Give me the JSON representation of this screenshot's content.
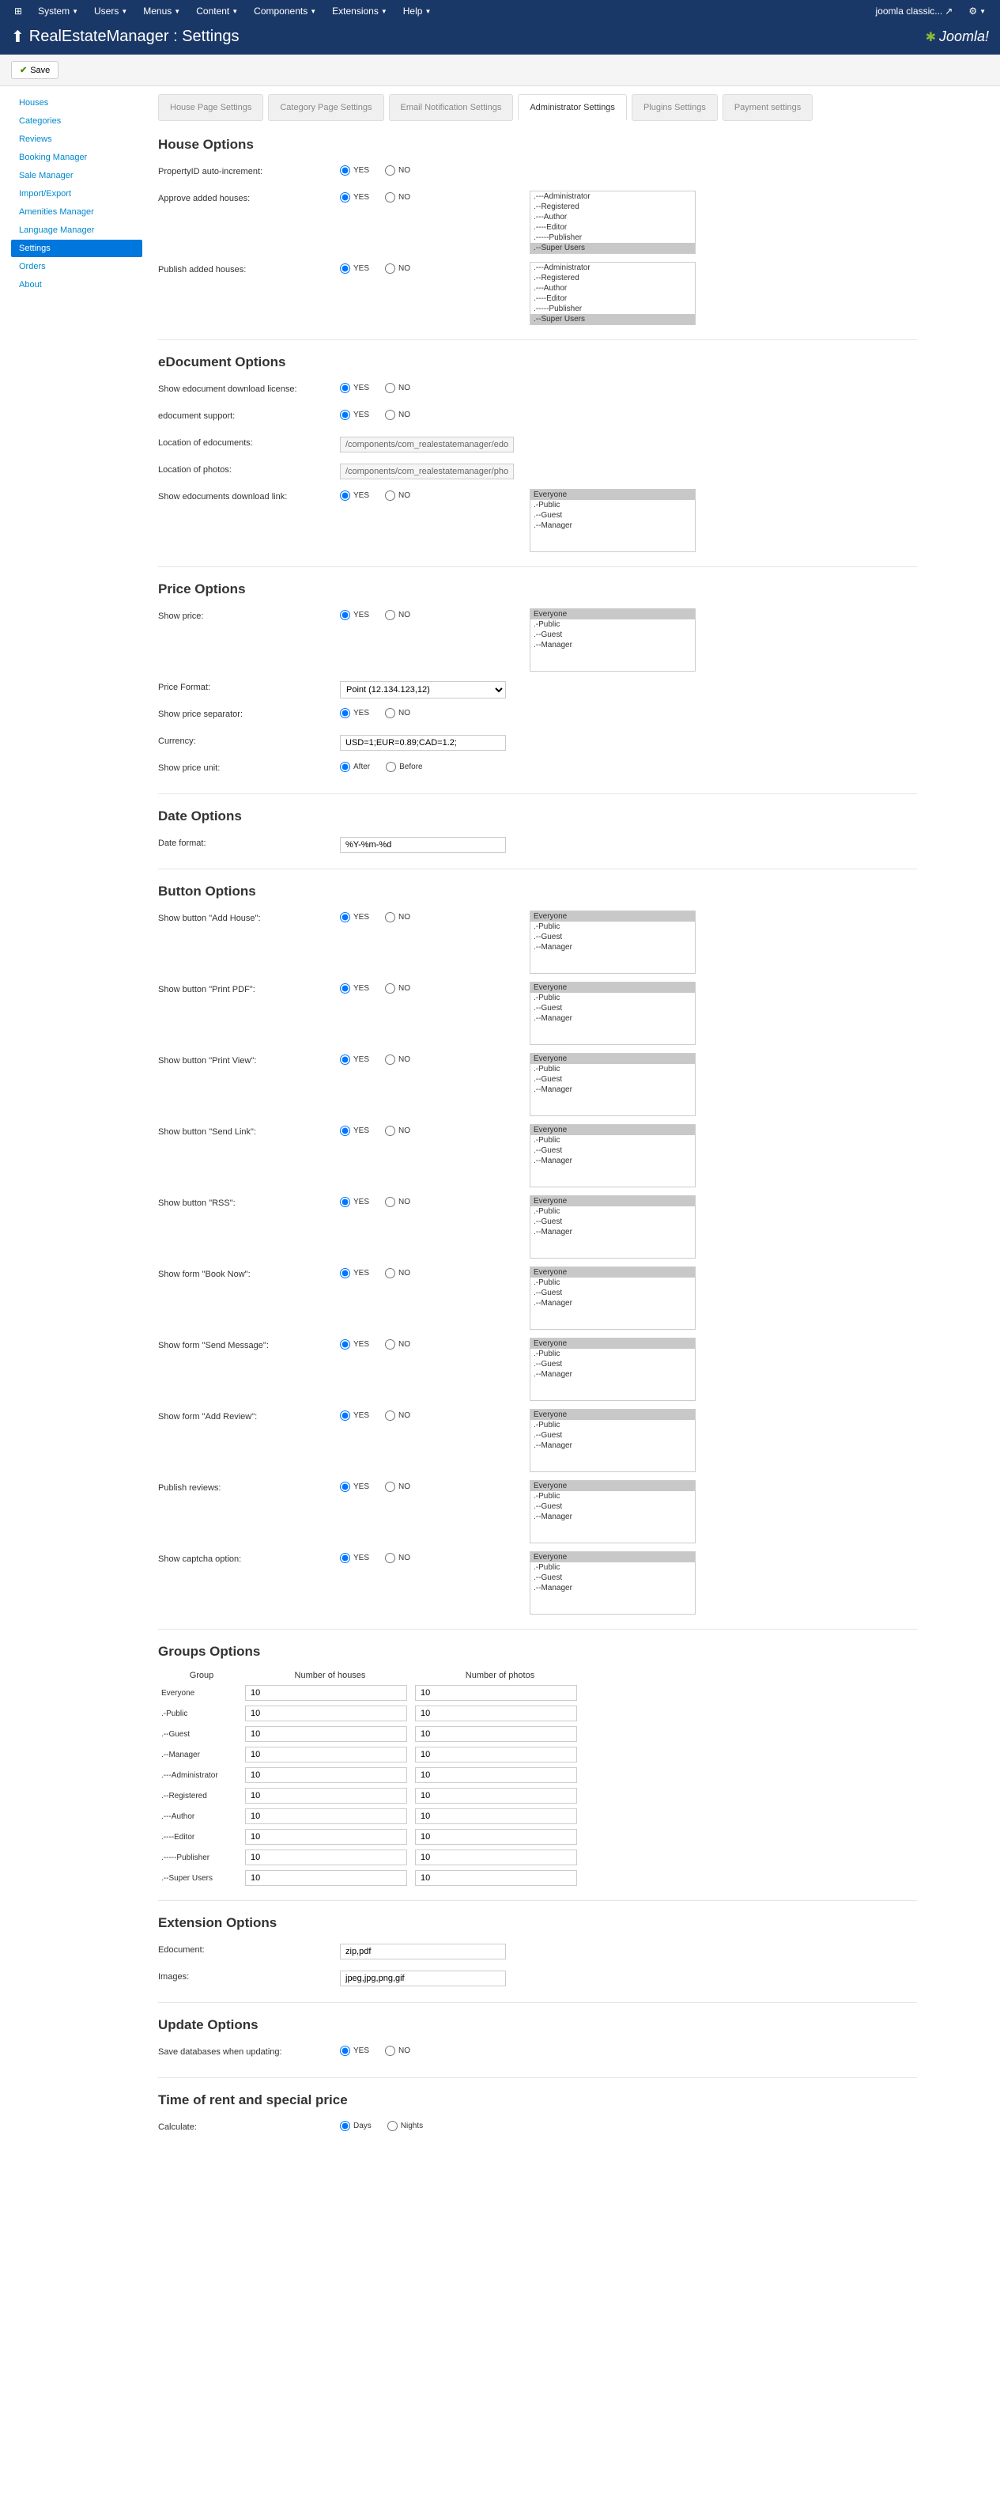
{
  "topbar": {
    "left": [
      "System",
      "Users",
      "Menus",
      "Content",
      "Components",
      "Extensions",
      "Help"
    ],
    "right_text": "joomla classic...",
    "logo_text": "Joomla!"
  },
  "header": {
    "title": "RealEstateManager : Settings"
  },
  "toolbar": {
    "save": "Save"
  },
  "sidebar": {
    "items": [
      "Houses",
      "Categories",
      "Reviews",
      "Booking Manager",
      "Sale Manager",
      "Import/Export",
      "Amenities Manager",
      "Language Manager",
      "Settings",
      "Orders",
      "About"
    ],
    "active": "Settings"
  },
  "tabs": {
    "items": [
      "House Page Settings",
      "Category Page Settings",
      "Email Notification Settings",
      "Administrator Settings",
      "Plugins Settings",
      "Payment settings"
    ],
    "active": "Administrator Settings"
  },
  "radio": {
    "yes": "YES",
    "no": "NO",
    "after": "After",
    "before": "Before",
    "days": "Days",
    "nights": "Nights"
  },
  "userlevels": {
    "full": [
      "Everyone",
      ".-Public",
      ".--Guest",
      ".--Manager",
      ".---Administrator",
      ".--Registered",
      ".---Author",
      ".----Editor",
      ".-----Publisher",
      ".--Super Users"
    ],
    "short": [
      "Everyone",
      ".-Public",
      ".--Guest",
      ".--Manager"
    ]
  },
  "house": {
    "title": "House Options",
    "r1": "PropertyID auto-increment:",
    "r2": "Approve added houses:",
    "r3": "Publish added houses:"
  },
  "edoc": {
    "title": "eDocument Options",
    "r1": "Show edocument download license:",
    "r2": "edocument support:",
    "r3": "Location of edocuments:",
    "r3v": "/components/com_realestatemanager/edocs/",
    "r4": "Location of photos:",
    "r4v": "/components/com_realestatemanager/photos/",
    "r5": "Show edocuments download link:"
  },
  "price": {
    "title": "Price Options",
    "r1": "Show price:",
    "r2": "Price Format:",
    "r2v": "Point (12.134.123,12)",
    "r3": "Show price separator:",
    "r4": "Currency:",
    "r4v": "USD=1;EUR=0.89;CAD=1.2;",
    "r5": "Show price unit:"
  },
  "date": {
    "title": "Date Options",
    "r1": "Date format:",
    "r1v": "%Y-%m-%d"
  },
  "button": {
    "title": "Button Options",
    "rows": [
      "Show button \"Add House\":",
      "Show button \"Print PDF\":",
      "Show button \"Print View\":",
      "Show button \"Send Link\":",
      "Show button \"RSS\":",
      "Show form \"Book Now\":",
      "Show form \"Send Message\":",
      "Show form \"Add Review\":",
      "Publish reviews:",
      "Show captcha option:"
    ]
  },
  "groups": {
    "title": "Groups Options",
    "h1": "Group",
    "h2": "Number of houses",
    "h3": "Number of photos",
    "rows": [
      {
        "g": "Everyone",
        "h": "10",
        "p": "10"
      },
      {
        "g": ".-Public",
        "h": "10",
        "p": "10"
      },
      {
        "g": ".--Guest",
        "h": "10",
        "p": "10"
      },
      {
        "g": ".--Manager",
        "h": "10",
        "p": "10"
      },
      {
        "g": ".---Administrator",
        "h": "10",
        "p": "10"
      },
      {
        "g": ".--Registered",
        "h": "10",
        "p": "10"
      },
      {
        "g": ".---Author",
        "h": "10",
        "p": "10"
      },
      {
        "g": ".----Editor",
        "h": "10",
        "p": "10"
      },
      {
        "g": ".-----Publisher",
        "h": "10",
        "p": "10"
      },
      {
        "g": ".--Super Users",
        "h": "10",
        "p": "10"
      }
    ]
  },
  "ext": {
    "title": "Extension Options",
    "r1": "Edocument:",
    "r1v": "zip,pdf",
    "r2": "Images:",
    "r2v": "jpeg,jpg,png,gif"
  },
  "update": {
    "title": "Update Options",
    "r1": "Save databases when updating:"
  },
  "rent": {
    "title": "Time of rent and special price",
    "r1": "Calculate:"
  }
}
